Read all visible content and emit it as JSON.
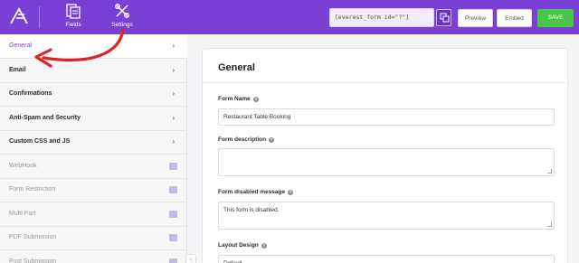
{
  "topbar": {
    "nav": [
      {
        "label": "Fields",
        "icon": "fields-icon"
      },
      {
        "label": "Settings",
        "icon": "settings-tools-icon"
      }
    ],
    "shortcode": "[everest_form id=\"?\"]",
    "preview_label": "Preview",
    "embed_label": "Embed",
    "save_label": "SAVE",
    "accent_color": "#7a3fd4",
    "save_color": "#49c54a"
  },
  "sidebar": {
    "items": [
      {
        "label": "General",
        "state": "active"
      },
      {
        "label": "Email",
        "state": "normal"
      },
      {
        "label": "Confirmations",
        "state": "normal"
      },
      {
        "label": "Anti-Spam and Security",
        "state": "normal"
      },
      {
        "label": "Custom CSS and JS",
        "state": "normal"
      },
      {
        "label": "WebHook",
        "state": "locked"
      },
      {
        "label": "Form Restriction",
        "state": "locked"
      },
      {
        "label": "Multi Part",
        "state": "locked"
      },
      {
        "label": "PDF Submission",
        "state": "locked"
      },
      {
        "label": "Post Submission",
        "state": "locked"
      }
    ],
    "chevron": "›"
  },
  "main": {
    "title": "General",
    "fields": {
      "form_name": {
        "label": "Form Name",
        "value": "Restaurant Table Booking"
      },
      "form_description": {
        "label": "Form description",
        "value": ""
      },
      "form_disabled_message": {
        "label": "Form disabled message",
        "value": "This form is disabled."
      },
      "layout_design": {
        "label": "Layout Design",
        "value": "Default"
      }
    }
  },
  "annotation": {
    "color": "#e02424"
  }
}
